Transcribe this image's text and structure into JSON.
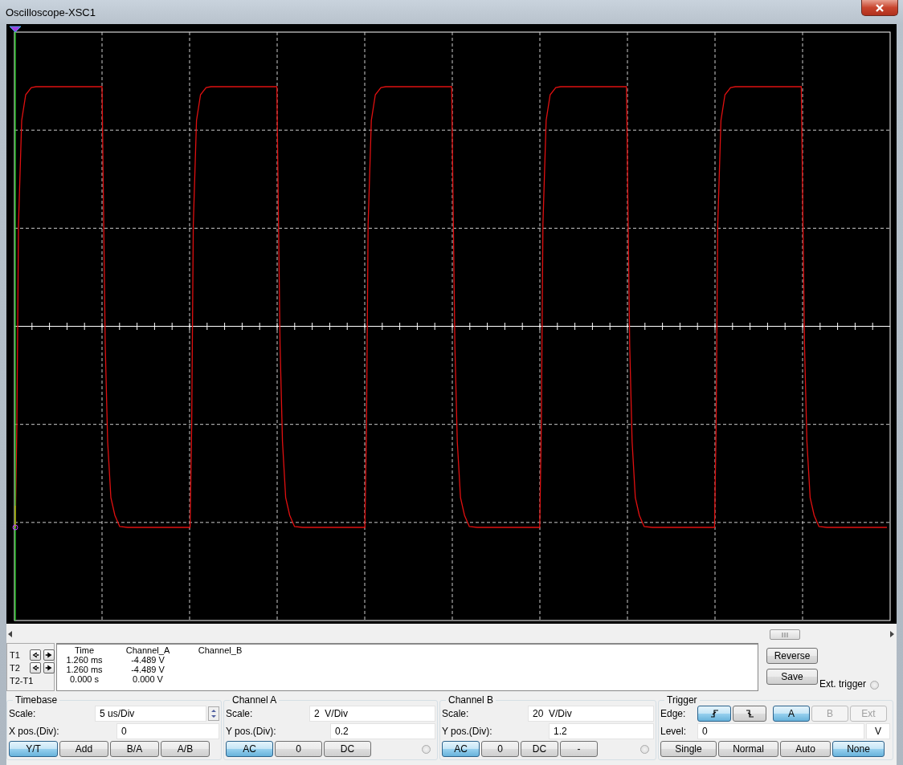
{
  "window": {
    "title": "Oscilloscope-XSC1"
  },
  "readout": {
    "columns": [
      "Time",
      "Channel_A",
      "Channel_B"
    ],
    "rows": [
      {
        "label": "T1",
        "kind": "cursor",
        "cells": [
          "1.260 ms",
          "-4.489 V"
        ]
      },
      {
        "label": "T2",
        "kind": "cursor",
        "cells": [
          "1.260 ms",
          "-4.489 V"
        ]
      },
      {
        "label": "T2-T1",
        "kind": "difference",
        "cells": [
          "0.000 s",
          "0.000 V"
        ]
      }
    ]
  },
  "actions": [
    {
      "label": "Reverse"
    },
    {
      "label": "Save"
    }
  ],
  "ext_trigger": {
    "label": "Ext. trigger",
    "checked": false
  },
  "timebase": {
    "title": "Timebase",
    "scale": {
      "label": "Scale:",
      "value": "5 us/Div"
    },
    "position": {
      "label": "X pos.(Div):",
      "value": "0"
    },
    "modes": [
      {
        "label": "Y/T",
        "selected": true
      },
      {
        "label": "Add",
        "selected": false
      },
      {
        "label": "B/A",
        "selected": false
      },
      {
        "label": "A/B",
        "selected": false
      }
    ]
  },
  "channels": [
    {
      "title": "Channel A",
      "scale": {
        "label": "Scale:",
        "value": "2  V/Div"
      },
      "position": {
        "label": "Y pos.(Div):",
        "value": "0.2"
      },
      "indicator_on": false,
      "coupling": [
        {
          "label": "AC",
          "selected": true
        },
        {
          "label": "0",
          "selected": false
        },
        {
          "label": "DC",
          "selected": false
        }
      ]
    },
    {
      "title": "Channel B",
      "scale": {
        "label": "Scale:",
        "value": "20  V/Div"
      },
      "position": {
        "label": "Y pos.(Div):",
        "value": "1.2"
      },
      "indicator_on": false,
      "coupling": [
        {
          "label": "AC",
          "selected": true
        },
        {
          "label": "0",
          "selected": false
        },
        {
          "label": "DC",
          "selected": false
        },
        {
          "label": "-",
          "selected": false
        }
      ]
    }
  ],
  "trigger": {
    "title": "Trigger",
    "edge_label": "Edge:",
    "edges": [
      {
        "kind": "rising",
        "selected": true
      },
      {
        "kind": "falling",
        "selected": false
      }
    ],
    "sources": [
      {
        "label": "A",
        "selected": true,
        "disabled": false
      },
      {
        "label": "B",
        "selected": false,
        "disabled": true
      },
      {
        "label": "Ext",
        "selected": false,
        "disabled": true
      }
    ],
    "level": {
      "label": "Level:",
      "value": "0",
      "unit": "V"
    },
    "modes": [
      {
        "label": "Single",
        "selected": false
      },
      {
        "label": "Normal",
        "selected": false
      },
      {
        "label": "Auto",
        "selected": false
      },
      {
        "label": "None",
        "selected": true
      }
    ]
  }
}
